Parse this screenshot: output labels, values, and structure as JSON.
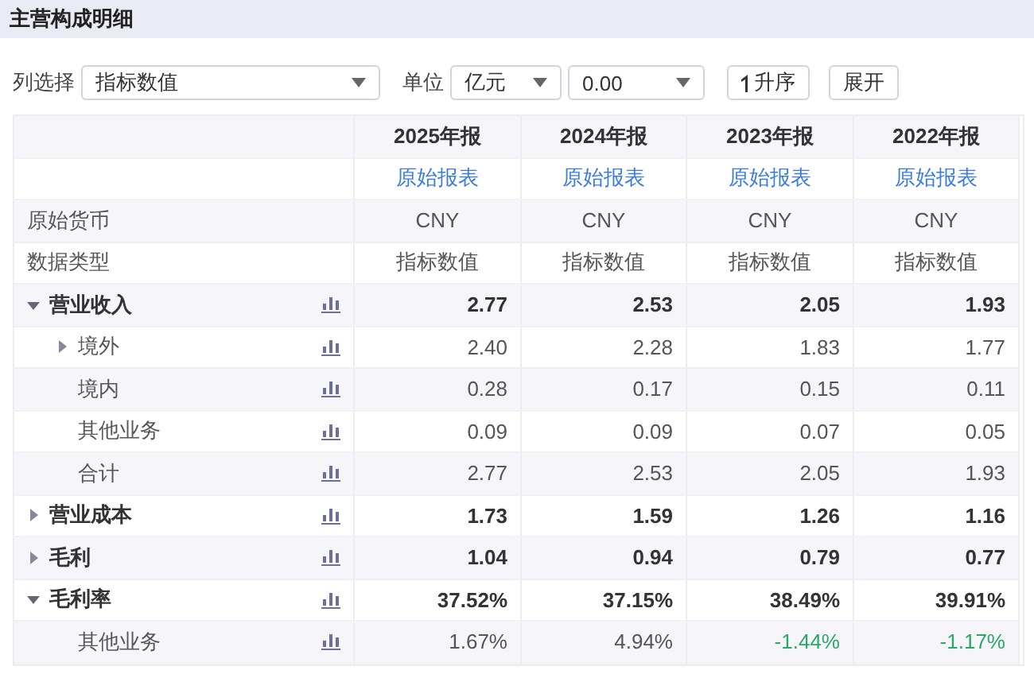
{
  "title": "主营构成明细",
  "toolbar": {
    "column_label": "列选择",
    "column_select": "指标数值",
    "unit_label": "单位",
    "unit_select": "亿元",
    "precision_select": "0.00",
    "sort_button": "升序",
    "expand_button": "展开"
  },
  "table": {
    "columns": [
      "2025年报",
      "2024年报",
      "2023年报",
      "2022年报"
    ],
    "links": [
      "原始报表",
      "原始报表",
      "原始报表",
      "原始报表"
    ],
    "info_rows": [
      {
        "label": "原始货币",
        "values": [
          "CNY",
          "CNY",
          "CNY",
          "CNY"
        ]
      },
      {
        "label": "数据类型",
        "values": [
          "指标数值",
          "指标数值",
          "指标数值",
          "指标数值"
        ]
      }
    ],
    "rows": [
      {
        "label": "营业收入",
        "expanded": true,
        "values": [
          "2.77",
          "2.53",
          "2.05",
          "1.93"
        ],
        "children": [
          {
            "label": "境外",
            "expanded": false,
            "values": [
              "2.40",
              "2.28",
              "1.83",
              "1.77"
            ]
          },
          {
            "label": "境内",
            "values": [
              "0.28",
              "0.17",
              "0.15",
              "0.11"
            ]
          },
          {
            "label": "其他业务",
            "values": [
              "0.09",
              "0.09",
              "0.07",
              "0.05"
            ]
          },
          {
            "label": "合计",
            "values": [
              "2.77",
              "2.53",
              "2.05",
              "1.93"
            ]
          }
        ]
      },
      {
        "label": "营业成本",
        "expanded": false,
        "values": [
          "1.73",
          "1.59",
          "1.26",
          "1.16"
        ]
      },
      {
        "label": "毛利",
        "expanded": false,
        "values": [
          "1.04",
          "0.94",
          "0.79",
          "0.77"
        ]
      },
      {
        "label": "毛利率",
        "expanded": true,
        "values": [
          "37.52%",
          "37.15%",
          "38.49%",
          "39.91%"
        ],
        "children": [
          {
            "label": "其他业务",
            "values": [
              "1.67%",
              "4.94%",
              {
                "text": "-1.44%",
                "color": "#2aa864"
              },
              {
                "text": "-1.17%",
                "color": "#2aa864"
              }
            ]
          }
        ]
      }
    ]
  }
}
